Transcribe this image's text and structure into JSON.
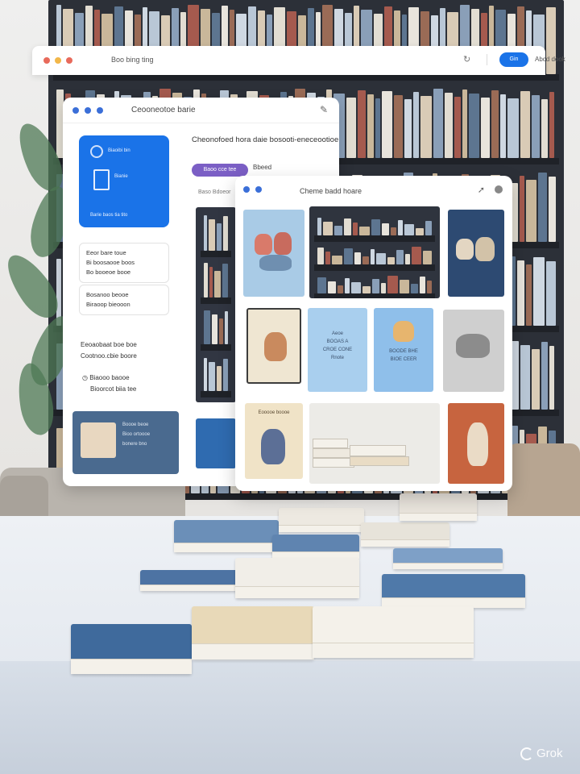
{
  "window_back": {
    "title": "Boo bing ting",
    "action_button": "Gin",
    "action_link": "Abcd dook"
  },
  "window_middle": {
    "title": "Ceooneotoe barie",
    "blue_card": {
      "line1": "Biaoibi bin",
      "line2": "Bianie",
      "line3": "Barie baos tia tito"
    },
    "panel1": [
      "Eeor bare toue",
      "Bi boosaooe boos",
      "Bo booeoe booe"
    ],
    "panel2": [
      "Bosanoo beooe",
      "Biraoop bieooon"
    ],
    "section_heading": [
      "Eeoaobaat boe boe",
      "Cootnoo.cbie boore"
    ],
    "list_item": [
      "Biaooo baooe",
      "Bioorcot biia tee"
    ],
    "main_heading": "Cheonofoed hora daie bosooti-eneceootioe",
    "tag_label": "Baoo cce tee",
    "tag_side": "Bbeed",
    "sub_label": "Baso Bdoeor",
    "thumb_lines": [
      "Boooe beoe",
      "Bioo ortoooe",
      "bonere bno"
    ]
  },
  "window_front": {
    "title": "Cheme badd hoare",
    "cover_text": [
      "Aeoe",
      "BOOAS A",
      "CROE CONE",
      "Rnote"
    ],
    "cover_text2": [
      "BOODE BHE",
      "BIOE CEER"
    ],
    "cover_text3": "Eooooe boooe"
  },
  "watermark": "Grok",
  "colors": {
    "accent_blue": "#1a73e8",
    "tag_purple": "#7b5fc5",
    "traffic_red": "#e86a5b",
    "traffic_yellow": "#f2b749",
    "traffic_green": "#5ab862",
    "window_dot_blue": "#3b6fd8"
  },
  "icons": {
    "refresh": "refresh-icon",
    "edit": "pencil-icon",
    "share": "share-icon",
    "more": "more-icon",
    "watermark": "grok-logo-icon"
  }
}
